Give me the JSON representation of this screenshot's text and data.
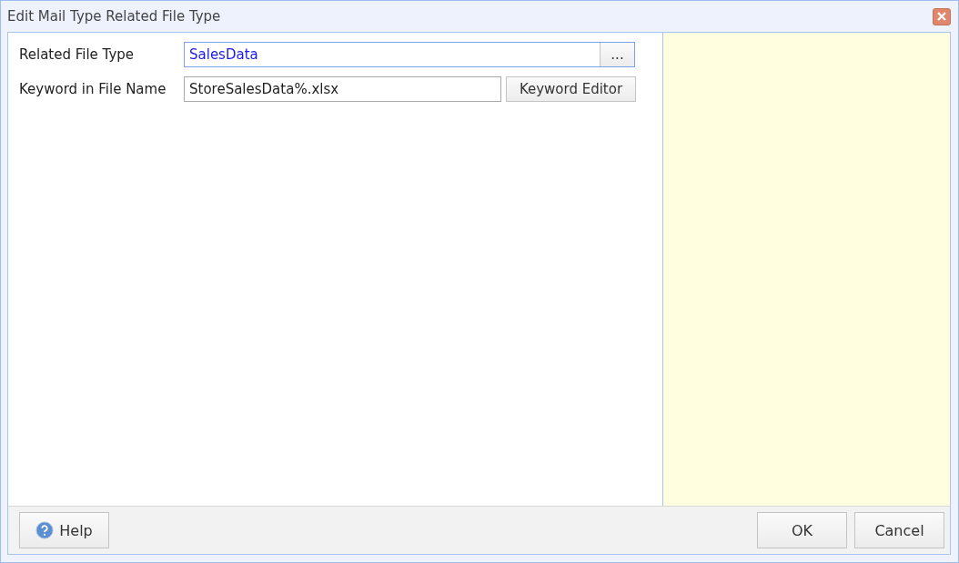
{
  "window": {
    "title": "Edit Mail Type Related File Type"
  },
  "fields": [
    {
      "label": "Related File Type",
      "kind": "lookup",
      "value": "SalesData",
      "focused": true,
      "button": "..."
    },
    {
      "label": "Keyword in File Name",
      "kind": "text",
      "value": "StoreSalesData%.xlsx",
      "focused": false,
      "button": "Keyword Editor"
    }
  ],
  "footer": {
    "help": "Help",
    "buttons": [
      "OK",
      "Cancel"
    ]
  }
}
